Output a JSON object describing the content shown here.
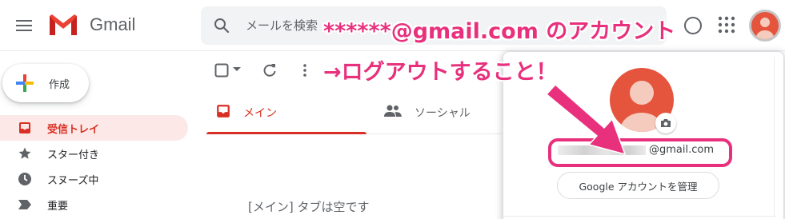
{
  "header": {
    "app_name": "Gmail",
    "search_placeholder": "メールを検索"
  },
  "sidebar": {
    "compose_label": "作成",
    "items": [
      {
        "label": "受信トレイ",
        "icon": "inbox-icon",
        "active": true
      },
      {
        "label": "スター付き",
        "icon": "star-icon",
        "active": false
      },
      {
        "label": "スヌーズ中",
        "icon": "clock-icon",
        "active": false
      },
      {
        "label": "重要",
        "icon": "label-important-icon",
        "active": false
      }
    ]
  },
  "tabs": [
    {
      "label": "メイン",
      "icon": "inbox-icon",
      "active": true
    },
    {
      "label": "ソーシャル",
      "icon": "people-icon",
      "active": false
    }
  ],
  "main": {
    "empty_message": "[メイン] タブは空です"
  },
  "account_popup": {
    "email_domain": "@gmail.com",
    "manage_button": "Google アカウントを管理"
  },
  "annotation": {
    "line1": "******@gmail.com のアカウント",
    "line2": "→ログアウトすること！"
  },
  "colors": {
    "accent": "#d93025",
    "annotation": "#e8307c",
    "avatar": "#e5543d"
  }
}
